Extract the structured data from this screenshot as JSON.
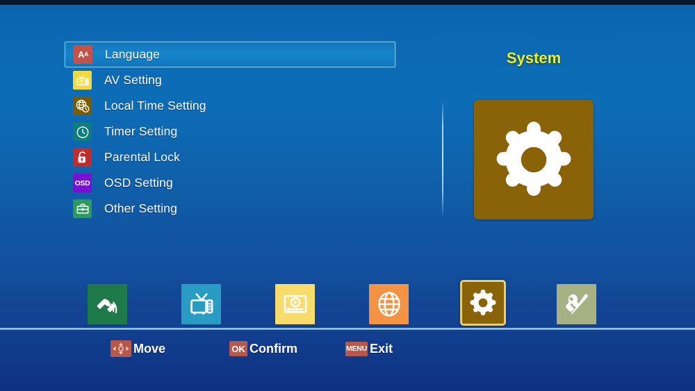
{
  "screen": {
    "panel_title": "System",
    "title_color": "#f2ef1e",
    "background_top_color": "#0a64ae",
    "background_bottom_color": "#0e3183"
  },
  "menu": {
    "selected_index": 0,
    "highlight_color": "#1584c9",
    "highlight_border_color": "#7dc4e8",
    "items": [
      {
        "label": "Language",
        "icon": "letter-aa-icon",
        "icon_bg": "#c4514a"
      },
      {
        "label": "AV Setting",
        "icon": "television-icon",
        "icon_bg": "#f2d93c"
      },
      {
        "label": "Local Time Setting",
        "icon": "globe-clock-icon",
        "icon_bg": "#7a5c06"
      },
      {
        "label": "Timer Setting",
        "icon": "clock-icon",
        "icon_bg": "#0d7d7d"
      },
      {
        "label": "Parental Lock",
        "icon": "padlock-icon",
        "icon_bg": "#c32c2c"
      },
      {
        "label": "OSD Setting",
        "icon": "osd-text-icon",
        "icon_bg": "#7a10d8"
      },
      {
        "label": "Other Setting",
        "icon": "toolbox-icon",
        "icon_bg": "#2a9b5c"
      }
    ]
  },
  "preview": {
    "icon": "gear-icon",
    "tile_color": "#8a6208"
  },
  "icon_strip": {
    "active_index": 4,
    "active_border_color": "#e8cf7d",
    "items": [
      {
        "name": "satellite-installation",
        "icon": "satellite-icon",
        "tile_color": "#1f7a4a"
      },
      {
        "name": "channel-manager",
        "icon": "television-icon",
        "tile_color": "#2a9cc4"
      },
      {
        "name": "multimedia",
        "icon": "media-player-icon",
        "tile_color": "#f7dc6b"
      },
      {
        "name": "network",
        "icon": "globe-icon",
        "tile_color": "#f49343"
      },
      {
        "name": "system",
        "icon": "gear-icon",
        "tile_color": "#8a6208"
      },
      {
        "name": "tools",
        "icon": "wrench-screwdriver-icon",
        "tile_color": "#a8b184"
      }
    ]
  },
  "help_bar": {
    "key_badge_color": "#b8584a",
    "items": [
      {
        "key": "",
        "key_icon": "dpad-arrows-icon",
        "label": "Move"
      },
      {
        "key": "OK",
        "key_icon": "ok-key-icon",
        "label": "Confirm"
      },
      {
        "key": "MENU",
        "key_icon": "menu-key-icon",
        "label": "Exit"
      }
    ]
  }
}
